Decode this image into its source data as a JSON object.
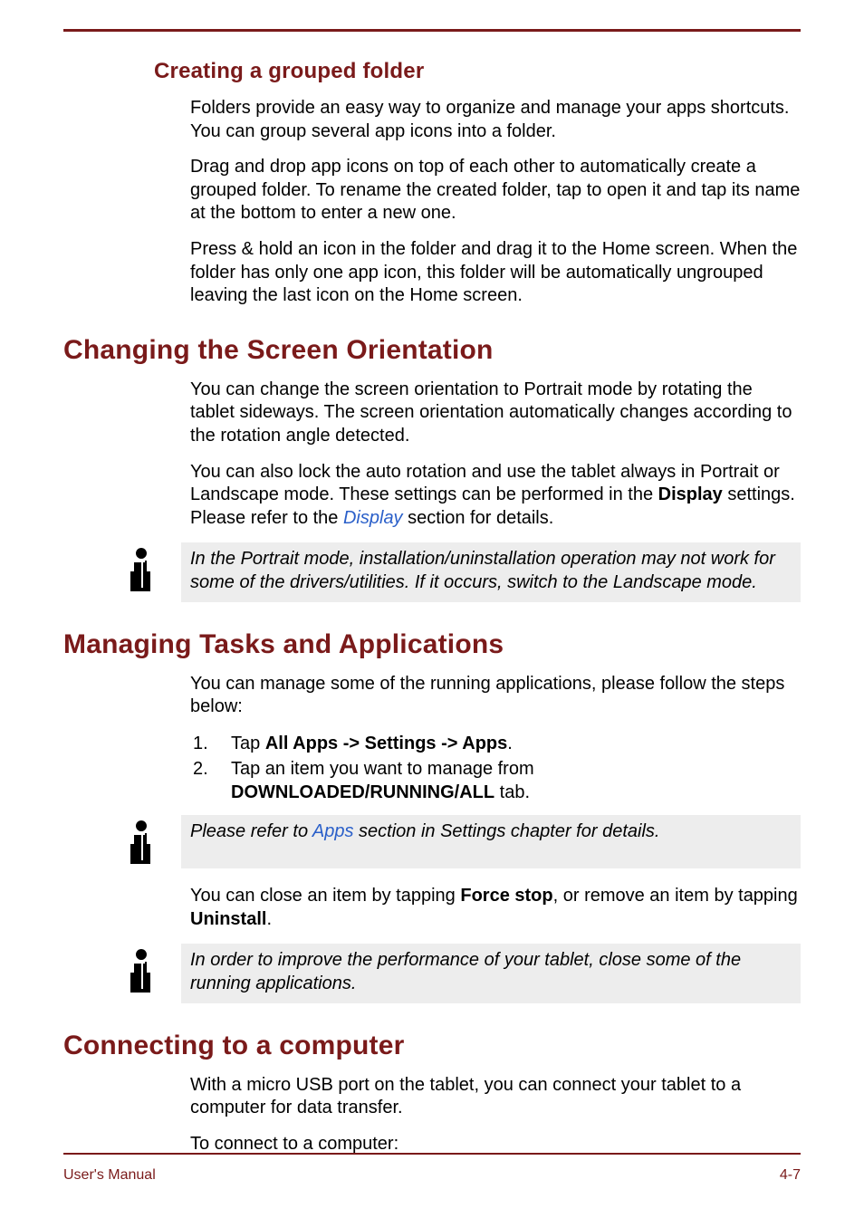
{
  "section_folder": {
    "heading": "Creating a grouped folder",
    "p1": "Folders provide an easy way to organize and manage your apps shortcuts. You can group several app icons into a folder.",
    "p2": "Drag and drop app icons on top of each other to automatically create a grouped folder. To rename the created folder, tap to open it and tap its name at the bottom to enter a new one.",
    "p3": "Press & hold an icon in the folder and drag it to the Home screen. When the folder has only one app icon, this folder will be automatically ungrouped leaving the last icon on the Home screen."
  },
  "section_orientation": {
    "heading": "Changing the Screen Orientation",
    "p1": "You can change the screen orientation to Portrait mode by rotating the tablet sideways. The screen orientation automatically changes according to the rotation angle detected.",
    "p2a": "You can also lock the auto rotation and use the tablet always in Portrait or Landscape mode. These settings can be performed in the ",
    "p2b_bold": "Display",
    "p2c": " settings. Please refer to the ",
    "p2_link": "Display",
    "p2d": " section for details.",
    "note": "In the Portrait mode, installation/uninstallation operation may not work for some of the drivers/utilities. If it occurs, switch to the Landscape mode."
  },
  "section_tasks": {
    "heading": "Managing Tasks and Applications",
    "intro": "You can manage some of the running applications, please follow the steps below:",
    "step1a": "Tap ",
    "step1b_bold": "All Apps -> Settings -> Apps",
    "step1c": ".",
    "step2a": "Tap an item you want to manage from ",
    "step2b_bold": "DOWNLOADED/RUNNING/ALL",
    "step2c": " tab.",
    "note1a": "Please refer to ",
    "note1_link": "Apps",
    "note1b": " section in Settings chapter for details.",
    "close_a": "You can close an item by tapping ",
    "close_b_bold": "Force stop",
    "close_c": ", or remove an item by tapping ",
    "close_d_bold": "Uninstall",
    "close_e": ".",
    "note2": "In order to improve the performance of your tablet, close some of the running applications."
  },
  "section_connect": {
    "heading": "Connecting to a computer",
    "p1": "With a micro USB port on the tablet, you can connect your tablet to a computer for data transfer.",
    "p2": "To connect to a computer:"
  },
  "footer": {
    "left": "User's Manual",
    "right": "4-7"
  }
}
